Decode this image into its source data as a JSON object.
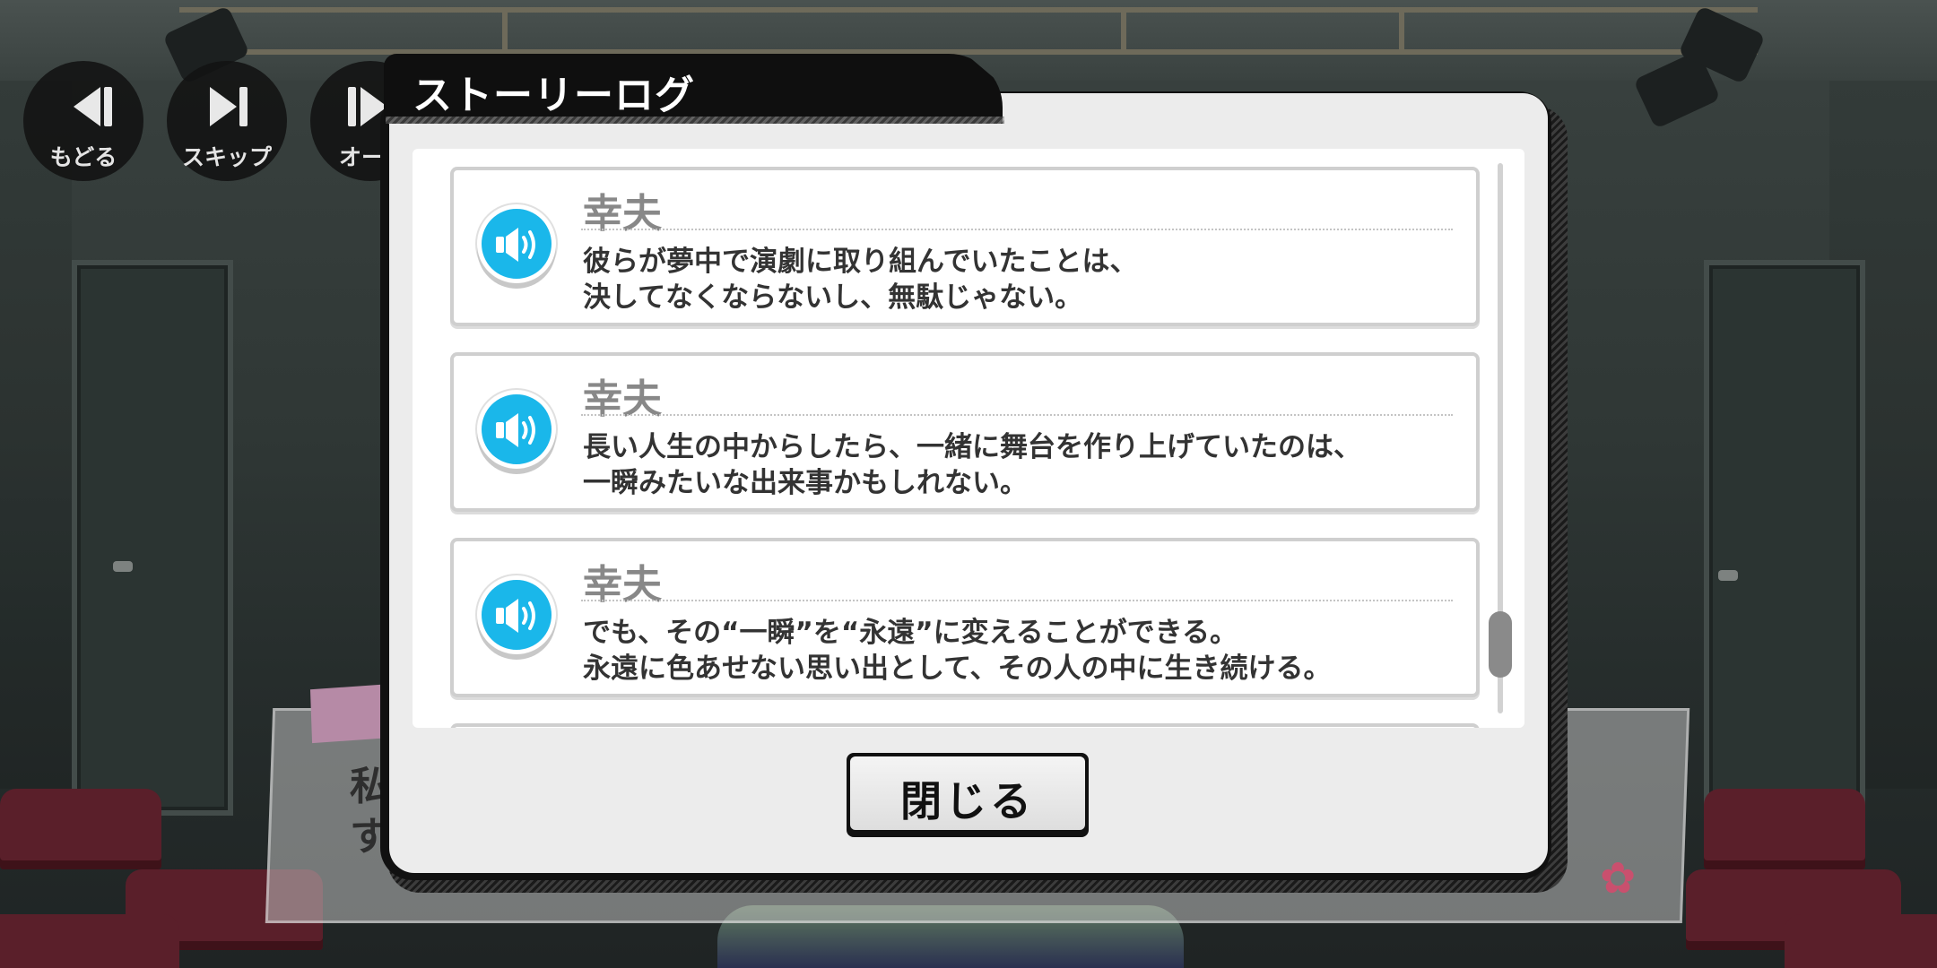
{
  "controls": [
    {
      "label": "もどる",
      "icon": "rewind-icon"
    },
    {
      "label": "スキップ",
      "icon": "skip-forward-icon"
    },
    {
      "label": "オー",
      "icon": "auto-play-icon"
    }
  ],
  "background_dialog": {
    "line1": "私",
    "line2": "す"
  },
  "story_log": {
    "title": "ストーリーログ",
    "entries": [
      {
        "speaker": "幸夫",
        "line1": "彼らが夢中で演劇に取り組んでいたことは、",
        "line2": "決してなくならないし、無駄じゃない。"
      },
      {
        "speaker": "幸夫",
        "line1": "長い人生の中からしたら、一緒に舞台を作り上げていたのは、",
        "line2": "一瞬みたいな出来事かもしれない。"
      },
      {
        "speaker": "幸夫",
        "line1": "でも、その“一瞬”を“永遠”に変えることができる。",
        "line2": "永遠に色あせない思い出として、その人の中に生き続ける。"
      }
    ],
    "close_label": "閉じる"
  },
  "colors": {
    "voice_button": "#1ab7ea",
    "title_bar": "#0f0f0f",
    "panel": "#ececec"
  }
}
